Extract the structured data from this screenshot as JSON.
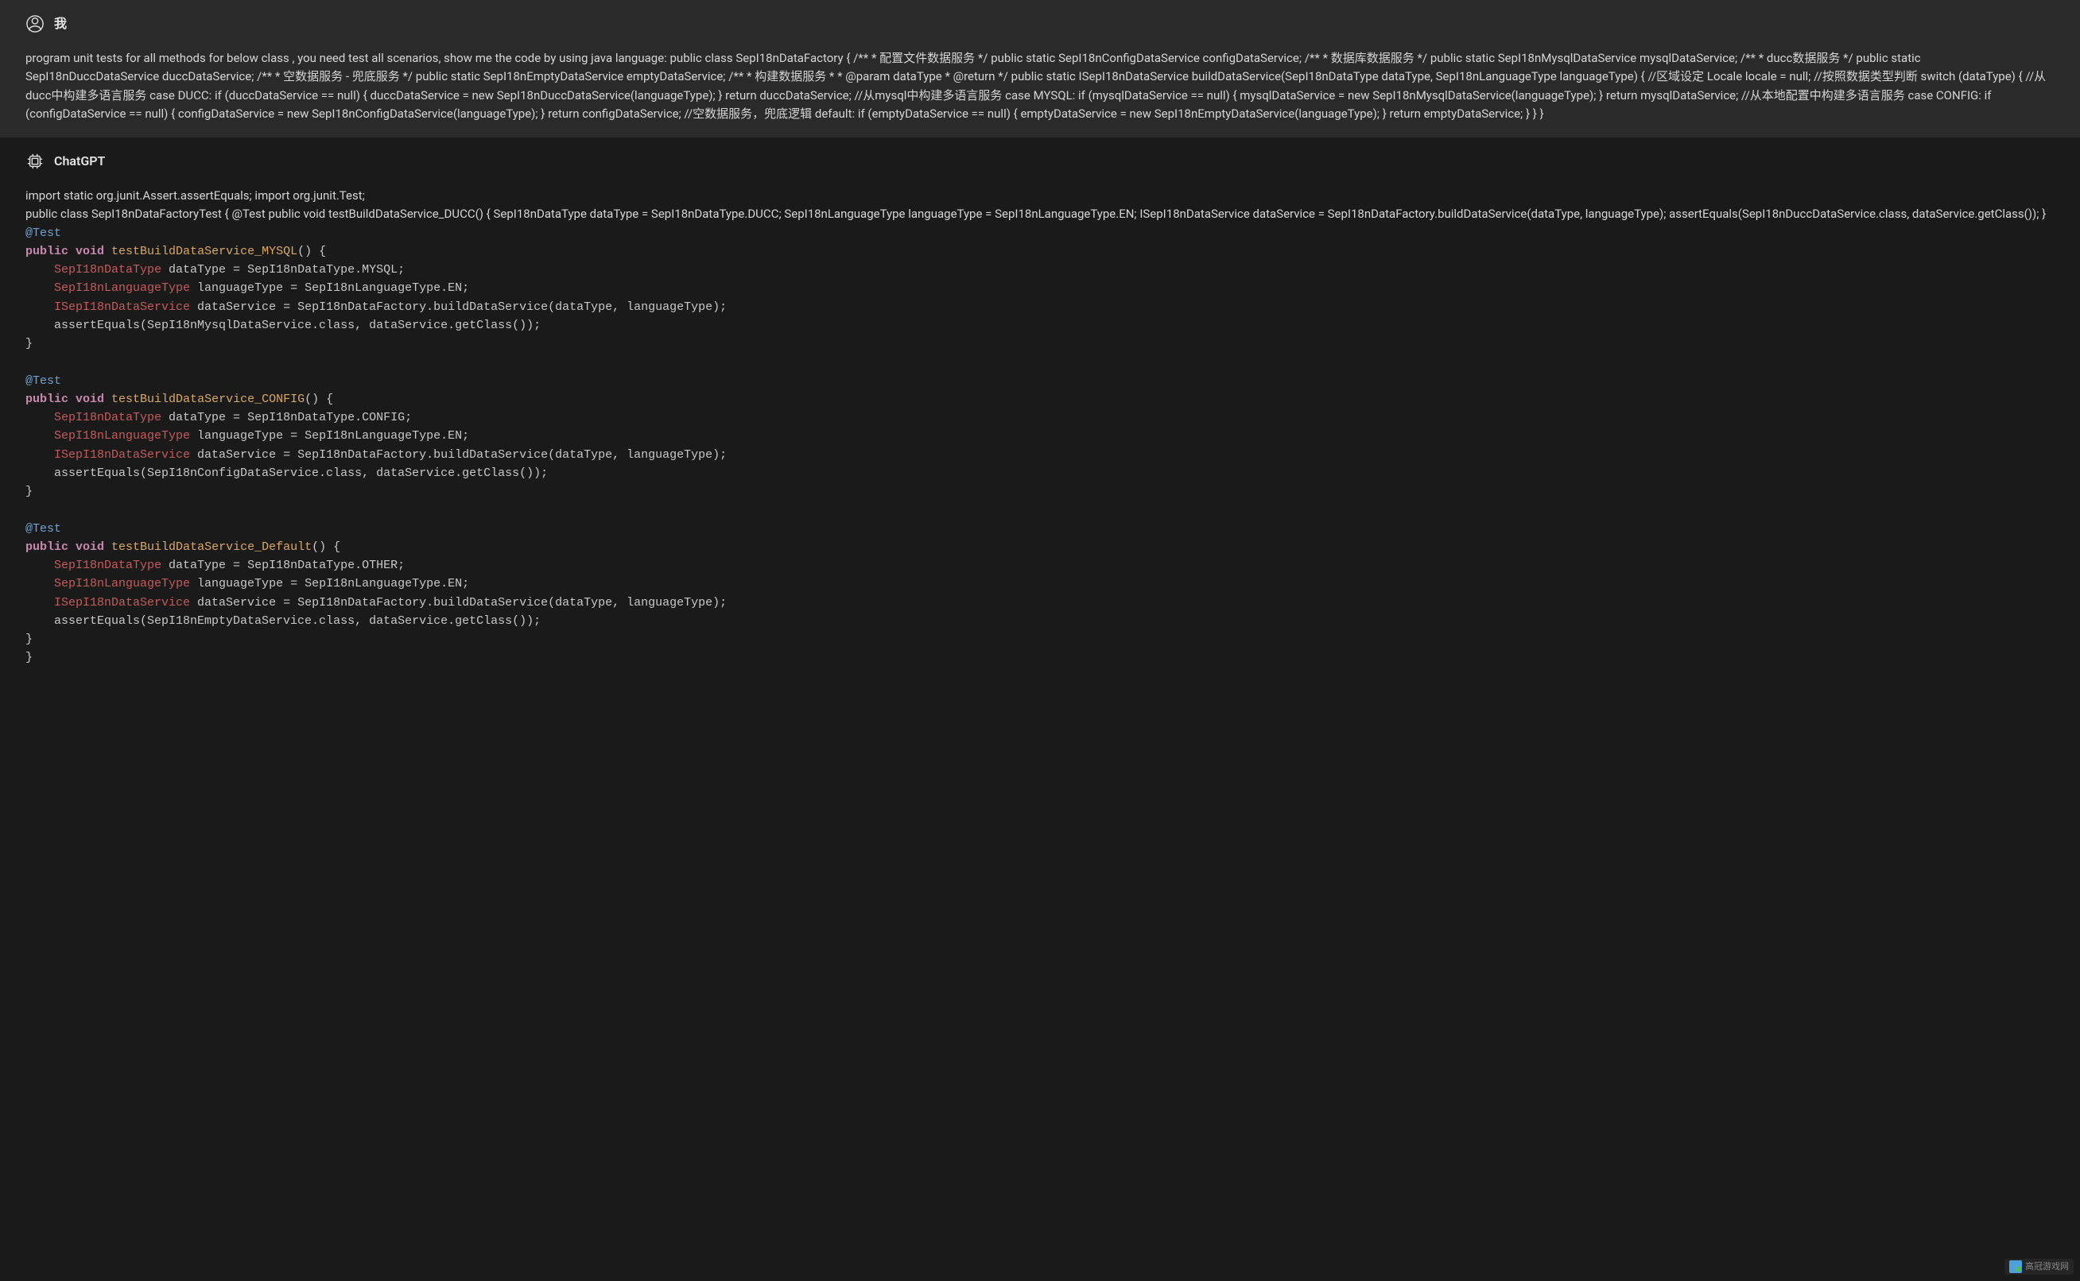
{
  "user": {
    "name": "我",
    "message": "program unit tests for all methods for below class , you need test all scenarios, show me the code by using java language: public class SepI18nDataFactory { /** * 配置文件数据服务 */ public static SepI18nConfigDataService configDataService; /** * 数据库数据服务 */ public static SepI18nMysqlDataService mysqlDataService; /** * ducc数据服务 */ public static SepI18nDuccDataService duccDataService; /** * 空数据服务 - 兜底服务 */ public static SepI18nEmptyDataService emptyDataService; /** * 构建数据服务 * * @param dataType * @return */ public static ISepI18nDataService buildDataService(SepI18nDataType dataType, SepI18nLanguageType languageType) { //区域设定 Locale locale = null; //按照数据类型判断 switch (dataType) { //从ducc中构建多语言服务 case DUCC: if (duccDataService == null) { duccDataService = new SepI18nDuccDataService(languageType); } return duccDataService; //从mysql中构建多语言服务 case MYSQL: if (mysqlDataService == null) { mysqlDataService = new SepI18nMysqlDataService(languageType); } return mysqlDataService; //从本地配置中构建多语言服务 case CONFIG: if (configDataService == null) { configDataService = new SepI18nConfigDataService(languageType); } return configDataService; //空数据服务，兜底逻辑 default: if (emptyDataService == null) { emptyDataService = new SepI18nEmptyDataService(languageType); } return emptyDataService; } } }"
  },
  "assistant": {
    "name": "ChatGPT",
    "intro_lines": [
      "import static org.junit.Assert.assertEquals; import org.junit.Test;",
      "public class SepI18nDataFactoryTest { @Test public void testBuildDataService_DUCC() { SepI18nDataType dataType = SepI18nDataType.DUCC; SepI18nLanguageType languageType = SepI18nLanguageType.EN; ISepI18nDataService dataService = SepI18nDataFactory.buildDataService(dataType, languageType); assertEquals(SepI18nDuccDataService.class, dataService.getClass()); }"
    ],
    "tests": [
      {
        "annotation": "@Test",
        "signature_prefix": "public void",
        "method_name": "testBuildDataService_MYSQL",
        "signature_suffix": "() {",
        "l1_type": "SepI18nDataType",
        "l1_rest": " dataType = SepI18nDataType.MYSQL;",
        "l2_type": "SepI18nLanguageType",
        "l2_rest": " languageType = SepI18nLanguageType.EN;",
        "l3_type": "ISepI18nDataService",
        "l3_rest": " dataService = SepI18nDataFactory.buildDataService(dataType, languageType);",
        "l4": "    assertEquals(SepI18nMysqlDataService.class, dataService.getClass());",
        "close": "}"
      },
      {
        "annotation": "@Test",
        "signature_prefix": "public void",
        "method_name": "testBuildDataService_CONFIG",
        "signature_suffix": "() {",
        "l1_type": "SepI18nDataType",
        "l1_rest": " dataType = SepI18nDataType.CONFIG;",
        "l2_type": "SepI18nLanguageType",
        "l2_rest": " languageType = SepI18nLanguageType.EN;",
        "l3_type": "ISepI18nDataService",
        "l3_rest": " dataService = SepI18nDataFactory.buildDataService(dataType, languageType);",
        "l4": "    assertEquals(SepI18nConfigDataService.class, dataService.getClass());",
        "close": "}"
      },
      {
        "annotation": "@Test",
        "signature_prefix": "public void",
        "method_name": "testBuildDataService_Default",
        "signature_suffix": "() {",
        "l1_type": "SepI18nDataType",
        "l1_rest": " dataType = SepI18nDataType.OTHER;",
        "l2_type": "SepI18nLanguageType",
        "l2_rest": " languageType = SepI18nLanguageType.EN;",
        "l3_type": "ISepI18nDataService",
        "l3_rest": " dataService = SepI18nDataFactory.buildDataService(dataType, languageType);",
        "l4": "    assertEquals(SepI18nEmptyDataService.class, dataService.getClass());",
        "close": "}"
      }
    ],
    "final_close": "}"
  },
  "watermark": {
    "text": "高冠游戏网"
  }
}
